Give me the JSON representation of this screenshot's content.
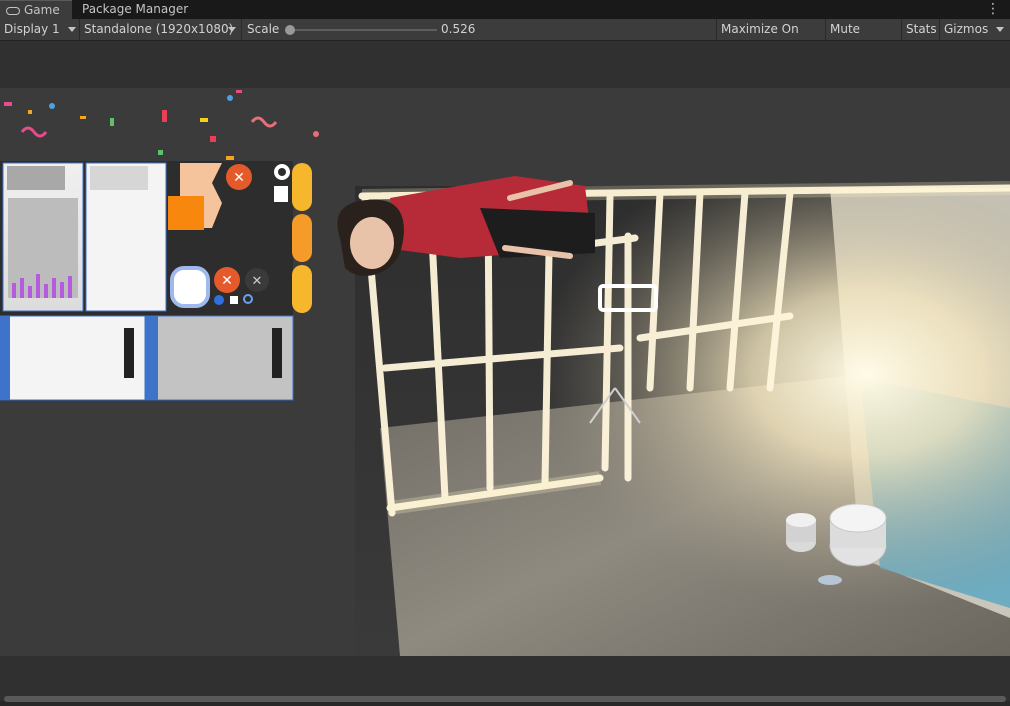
{
  "tabs": [
    {
      "label": "Game",
      "active": true
    },
    {
      "label": "Package Manager",
      "active": false
    }
  ],
  "toolbar": {
    "display": "Display 1",
    "resolution": "Standalone (1920x1080)",
    "scale_label": "Scale",
    "scale_value": "0.526",
    "maximize": "Maximize On Play",
    "mute": "Mute Audio",
    "stats": "Stats",
    "gizmos": "Gizmos"
  },
  "colors": {
    "editor_bg": "#282828",
    "toolbar_bg": "#3c3c3c",
    "accent_orange": "#f0852e",
    "accent_yellow": "#f6b72c",
    "close_red": "#e65a2e"
  }
}
